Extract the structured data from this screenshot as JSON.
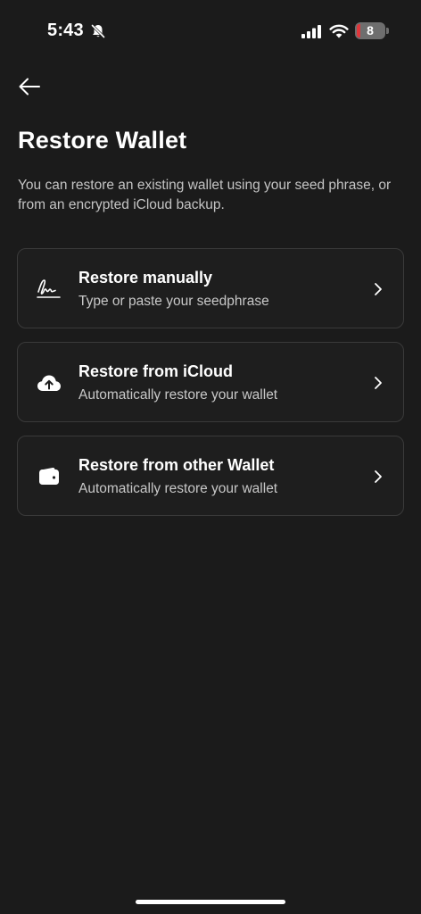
{
  "status_bar": {
    "time": "5:43",
    "battery_level": "8",
    "icons": [
      "bell-slash-icon",
      "cellular-signal-icon",
      "wifi-icon",
      "battery-icon"
    ]
  },
  "header": {
    "back_icon": "arrow-left-icon",
    "title": "Restore Wallet",
    "description": "You can restore an existing wallet using your seed phrase, or from an encrypted iCloud backup."
  },
  "options": [
    {
      "icon": "signature-icon",
      "title": "Restore manually",
      "subtitle": "Type or paste your seedphrase"
    },
    {
      "icon": "cloud-upload-icon",
      "title": "Restore from iCloud",
      "subtitle": "Automatically restore your wallet"
    },
    {
      "icon": "wallet-icon",
      "title": "Restore from other Wallet",
      "subtitle": "Automatically restore your wallet"
    }
  ],
  "colors": {
    "background": "#1b1b1b",
    "card_border": "#3a3a3a",
    "text_primary": "#ffffff",
    "text_secondary": "#c4c4c4",
    "battery_low": "#e0363b"
  }
}
